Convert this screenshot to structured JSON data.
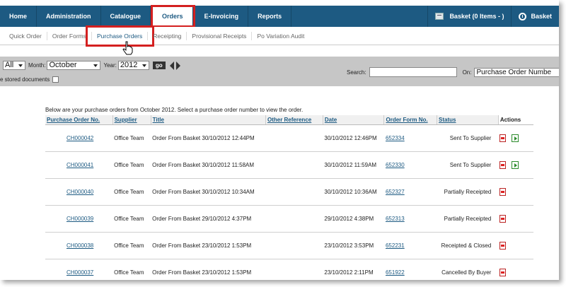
{
  "topnav": {
    "tabs": [
      {
        "label": "Home"
      },
      {
        "label": "Administration"
      },
      {
        "label": "Catalogue"
      },
      {
        "label": "Orders"
      },
      {
        "label": "E-Invoicing"
      },
      {
        "label": "Reports"
      }
    ],
    "active_tab": "Orders",
    "basket_label": "Basket (0 Items - )",
    "basket2_label": "Basket"
  },
  "subnav": {
    "items": [
      {
        "label": "Quick Order"
      },
      {
        "label": "Order Forms"
      },
      {
        "label": "Purchase Orders"
      },
      {
        "label": "Receipting"
      },
      {
        "label": "Provisional Receipts"
      },
      {
        "label": "Po Variation Audit"
      }
    ],
    "active_item": "Purchase Orders"
  },
  "filter": {
    "first_select": "All",
    "month_label": "Month:",
    "month_value": "October",
    "year_label": "Year:",
    "year_value": "2012",
    "go_label": "go",
    "stored_label": "e stored documents",
    "search_label": "Search:",
    "search_value": "",
    "on_label": "On:",
    "on_value": "Purchase Order Numbe"
  },
  "intro_text": "Below are your purchase orders from October 2012. Select a purchase order number to view the order.",
  "table": {
    "headers": [
      "Purchase Order No.",
      "Supplier",
      "Title",
      "Other Reference",
      "Date",
      "Order Form No.",
      "Status",
      "Actions"
    ],
    "rows": [
      {
        "po": "CH000042",
        "supplier": "Office Team",
        "title": "Order From Basket 30/10/2012 12:44PM",
        "ref": "",
        "date": "30/10/2012 12:46PM",
        "form": "652334",
        "status": "Sent To Supplier",
        "has_send": true
      },
      {
        "po": "CH000041",
        "supplier": "Office Team",
        "title": "Order From Basket 30/10/2012 11:58AM",
        "ref": "",
        "date": "30/10/2012 11:59AM",
        "form": "652330",
        "status": "Sent To Supplier",
        "has_send": true
      },
      {
        "po": "CH000040",
        "supplier": "Office Team",
        "title": "Order From Basket 30/10/2012 10:34AM",
        "ref": "",
        "date": "30/10/2012 10:36AM",
        "form": "652327",
        "status": "Partially Receipted",
        "has_send": false
      },
      {
        "po": "CH000039",
        "supplier": "Office Team",
        "title": "Order From Basket 29/10/2012 4:37PM",
        "ref": "",
        "date": "29/10/2012 4:38PM",
        "form": "652313",
        "status": "Partially Receipted",
        "has_send": false
      },
      {
        "po": "CH000038",
        "supplier": "Office Team",
        "title": "Order From Basket 23/10/2012 1:53PM",
        "ref": "",
        "date": "23/10/2012 3:53PM",
        "form": "652231",
        "status": "Receipted & Closed",
        "has_send": false
      },
      {
        "po": "CH000037",
        "supplier": "Office Team",
        "title": "Order From Basket 23/10/2012 1:53PM",
        "ref": "",
        "date": "23/10/2012 2:11PM",
        "form": "651922",
        "status": "Cancelled By Buyer",
        "has_send": false
      }
    ]
  },
  "icons": [
    "basket-icon",
    "clock-icon",
    "hand-cursor-icon",
    "pdf-icon",
    "send-icon",
    "arrow-left-icon",
    "arrow-right-icon"
  ],
  "colors": {
    "nav_bg": "#1d5a82",
    "highlight": "#d42020",
    "filter_bg": "#c6c6c6"
  }
}
